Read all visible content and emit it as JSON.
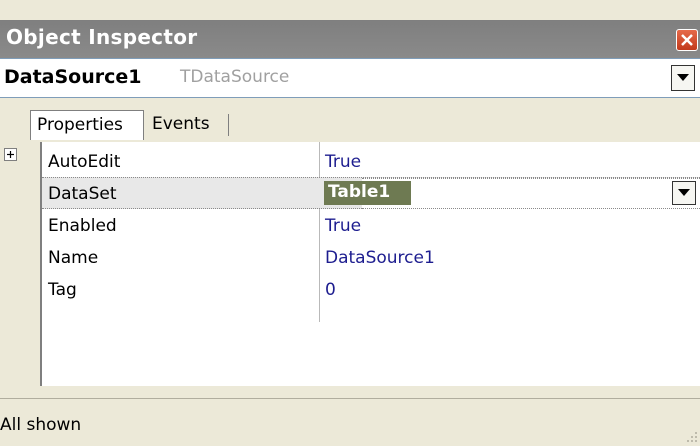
{
  "window": {
    "title": "Object Inspector"
  },
  "component_selector": {
    "name": "DataSource1",
    "type": "TDataSource"
  },
  "tabs": [
    {
      "label": "Properties",
      "active": true
    },
    {
      "label": "Events",
      "active": false
    }
  ],
  "properties": [
    {
      "name": "AutoEdit",
      "value": "True"
    },
    {
      "name": "DataSet",
      "value": "Table1",
      "selected": true,
      "expandable": true
    },
    {
      "name": "Enabled",
      "value": "True"
    },
    {
      "name": "Name",
      "value": "DataSource1"
    },
    {
      "name": "Tag",
      "value": "0"
    }
  ],
  "status": {
    "text": "All shown"
  },
  "colors": {
    "titlebar": "#808080",
    "value_text": "#1d1d8f",
    "selected_value_bg": "#6e7a52",
    "close_button": "#d4502f"
  },
  "icons": [
    "close-icon",
    "dropdown-arrow-icon",
    "expand-plus-icon",
    "size-grip-icon"
  ]
}
